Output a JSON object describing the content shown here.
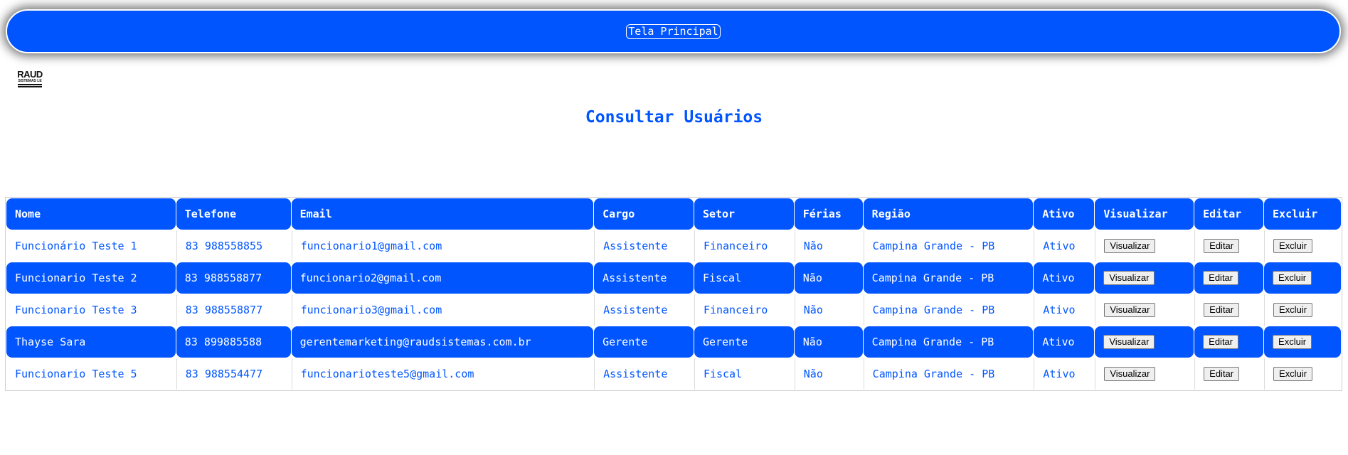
{
  "header": {
    "home_button": "Tela Principal"
  },
  "logo": {
    "line1": "RAUD",
    "line2": "SISTEMAS LE"
  },
  "page": {
    "title": "Consultar Usuários"
  },
  "table": {
    "columns": [
      "Nome",
      "Telefone",
      "Email",
      "Cargo",
      "Setor",
      "Férias",
      "Região",
      "Ativo",
      "Visualizar",
      "Editar",
      "Excluir"
    ],
    "rows": [
      {
        "nome": "Funcionário Teste 1",
        "telefone": "83 988558855",
        "email": "funcionario1@gmail.com",
        "cargo": "Assistente",
        "setor": "Financeiro",
        "ferias": "Não",
        "regiao": "Campina Grande - PB",
        "ativo": "Ativo"
      },
      {
        "nome": "Funcionario Teste 2",
        "telefone": "83 988558877",
        "email": "funcionario2@gmail.com",
        "cargo": "Assistente",
        "setor": "Fiscal",
        "ferias": "Não",
        "regiao": "Campina Grande - PB",
        "ativo": "Ativo"
      },
      {
        "nome": "Funcionario Teste 3",
        "telefone": "83 988558877",
        "email": "funcionario3@gmail.com",
        "cargo": "Assistente",
        "setor": "Financeiro",
        "ferias": "Não",
        "regiao": "Campina Grande - PB",
        "ativo": "Ativo"
      },
      {
        "nome": "Thayse Sara",
        "telefone": "83 899885588",
        "email": "gerentemarketing@raudsistemas.com.br",
        "cargo": "Gerente",
        "setor": "Gerente",
        "ferias": "Não",
        "regiao": "Campina Grande - PB",
        "ativo": "Ativo"
      },
      {
        "nome": "Funcionario Teste 5",
        "telefone": "83 988554477",
        "email": "funcionarioteste5@gmail.com",
        "cargo": "Assistente",
        "setor": "Fiscal",
        "ferias": "Não",
        "regiao": "Campina Grande - PB",
        "ativo": "Ativo"
      }
    ],
    "actions": {
      "view": "Visualizar",
      "edit": "Editar",
      "delete": "Excluir"
    }
  },
  "colors": {
    "primary": "#0055ff",
    "background": "#ffffff",
    "text_on_primary": "#ffffff"
  }
}
